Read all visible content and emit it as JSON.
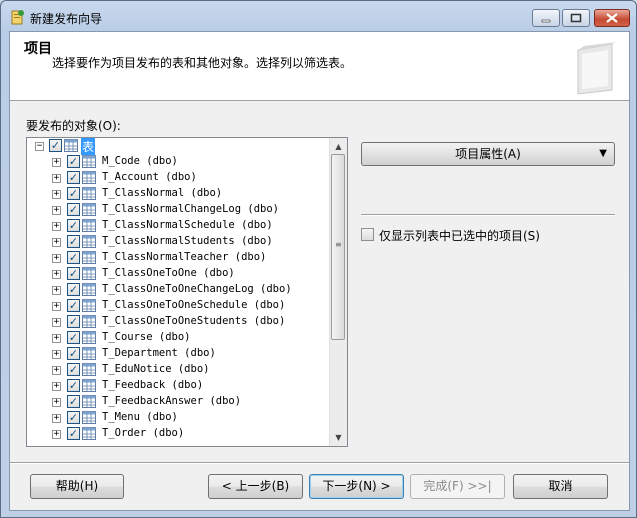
{
  "window": {
    "title": "新建发布向导",
    "accent": "#3399ff"
  },
  "header": {
    "title": "项目",
    "description": "选择要作为项目发布的表和其他对象。选择列以筛选表。"
  },
  "objects": {
    "label": "要发布的对象(O):",
    "root": {
      "label": "表",
      "checked": true
    },
    "items": [
      "M_Code (dbo)",
      "T_Account (dbo)",
      "T_ClassNormal (dbo)",
      "T_ClassNormalChangeLog (dbo)",
      "T_ClassNormalSchedule (dbo)",
      "T_ClassNormalStudents (dbo)",
      "T_ClassNormalTeacher (dbo)",
      "T_ClassOneToOne (dbo)",
      "T_ClassOneToOneChangeLog (dbo)",
      "T_ClassOneToOneSchedule (dbo)",
      "T_ClassOneToOneStudents (dbo)",
      "T_Course (dbo)",
      "T_Department (dbo)",
      "T_EduNotice (dbo)",
      "T_Feedback (dbo)",
      "T_FeedbackAnswer (dbo)",
      "T_Menu (dbo)",
      "T_Order (dbo)"
    ]
  },
  "properties": {
    "button_label": "项目属性(A)",
    "show_only_selected_label": "仅显示列表中已选中的项目(S)"
  },
  "buttons": {
    "help": "帮助(H)",
    "back": "< 上一步(B)",
    "next": "下一步(N) >",
    "finish": "完成(F) >>|",
    "cancel": "取消"
  }
}
